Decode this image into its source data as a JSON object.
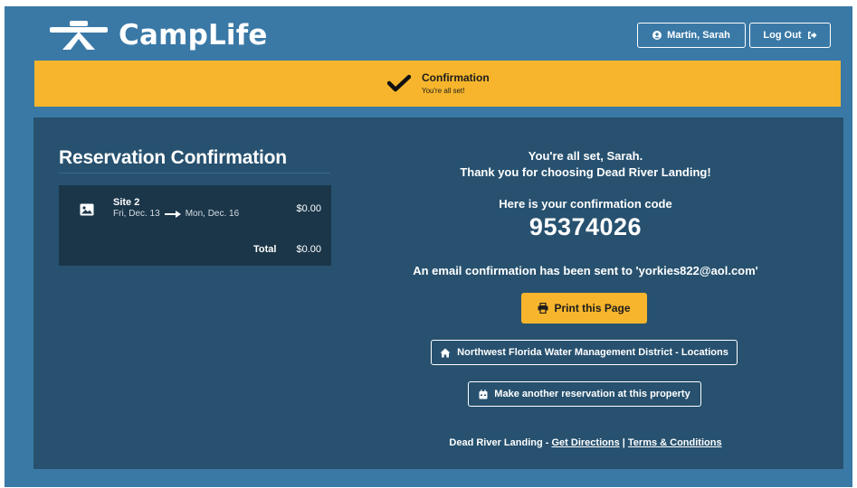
{
  "header": {
    "app_name": "CampLife",
    "user_button_label": "Martin, Sarah",
    "logout_button_label": "Log Out"
  },
  "banner": {
    "title": "Confirmation",
    "subtitle": "You're all set!"
  },
  "reservation": {
    "heading": "Reservation Confirmation",
    "site_name": "Site 2",
    "start_date": "Fri, Dec. 13",
    "end_date": "Mon, Dec. 16",
    "price": "$0.00",
    "total_label": "Total",
    "total_value": "$0.00"
  },
  "confirmation": {
    "line1": "You're all set, Sarah.",
    "line2": "Thank you for choosing Dead River Landing!",
    "code_label": "Here is your confirmation code",
    "code": "95374026",
    "email_message": "An email confirmation has been sent to 'yorkies822@aol.com'"
  },
  "actions": {
    "print_label": "Print this Page",
    "district_label": "Northwest Florida Water Management District - Locations",
    "another_label": "Make another reservation at this property"
  },
  "footer": {
    "property_name": "Dead River Landing -",
    "directions_link": "Get Directions",
    "separator": "|",
    "terms_link": "Terms & Conditions"
  },
  "colors": {
    "page_background": "#3a79a6",
    "panel_background": "#27516f",
    "card_background": "#1b3649",
    "accent": "#f6b52c"
  },
  "icons": [
    "camplife-logo-icon",
    "user-circle-icon",
    "logout-icon",
    "checkmark-icon",
    "image-icon",
    "arrow-right-icon",
    "print-icon",
    "home-icon",
    "calendar-icon"
  ]
}
